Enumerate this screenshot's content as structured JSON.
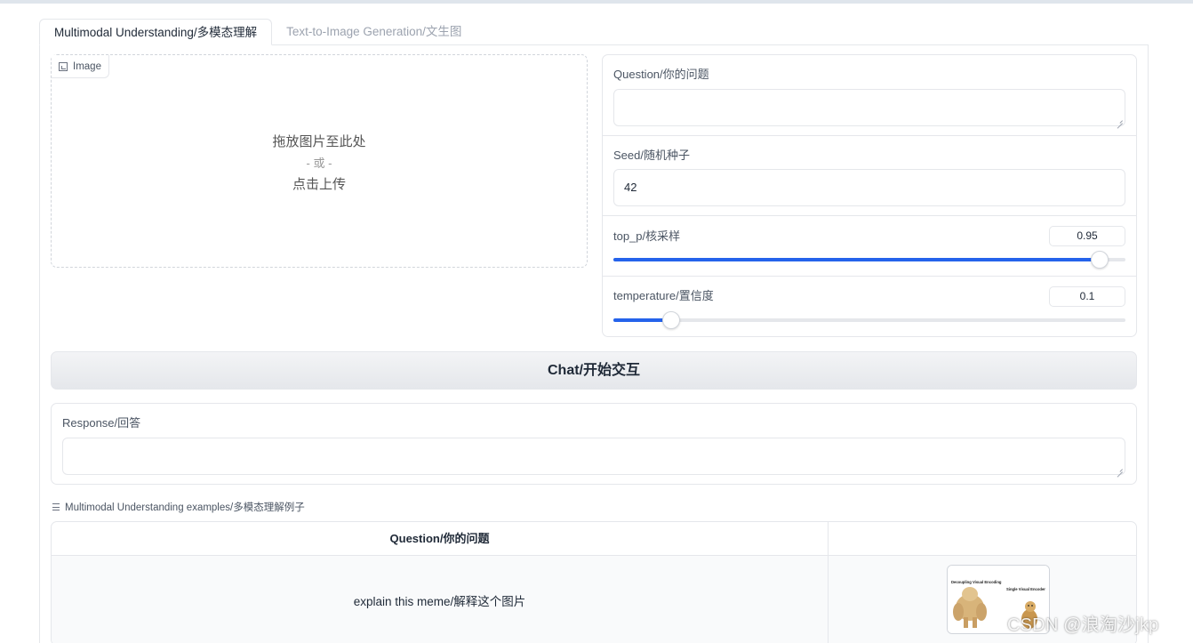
{
  "tabs": [
    {
      "label": "Multimodal Understanding/多模态理解",
      "active": true
    },
    {
      "label": "Text-to-Image Generation/文生图",
      "active": false
    }
  ],
  "image_upload": {
    "label": "Image",
    "drop_text": "拖放图片至此处",
    "or_text": "- 或 -",
    "click_text": "点击上传"
  },
  "question": {
    "label": "Question/你的问题",
    "value": ""
  },
  "seed": {
    "label": "Seed/随机种子",
    "value": "42"
  },
  "top_p": {
    "label": "top_p/核采样",
    "value": "0.95",
    "fraction": 0.95
  },
  "temperature": {
    "label": "temperature/置信度",
    "value": "0.1",
    "fraction": 0.113
  },
  "chat_button": {
    "label": "Chat/开始交互"
  },
  "response": {
    "label": "Response/回答",
    "value": ""
  },
  "examples": {
    "label": "Multimodal Understanding examples/多模态理解例子",
    "header": "Question/你的问题",
    "rows": [
      {
        "question": "explain this meme/解释这个图片",
        "thumbnail_caption_left": "Decoupling Visual Encoding",
        "thumbnail_caption_right": "Single Visual Encoder"
      }
    ]
  },
  "watermark": "CSDN @浪淘沙jkp",
  "colors": {
    "accent": "#2563eb",
    "border": "#e5e7eb"
  }
}
